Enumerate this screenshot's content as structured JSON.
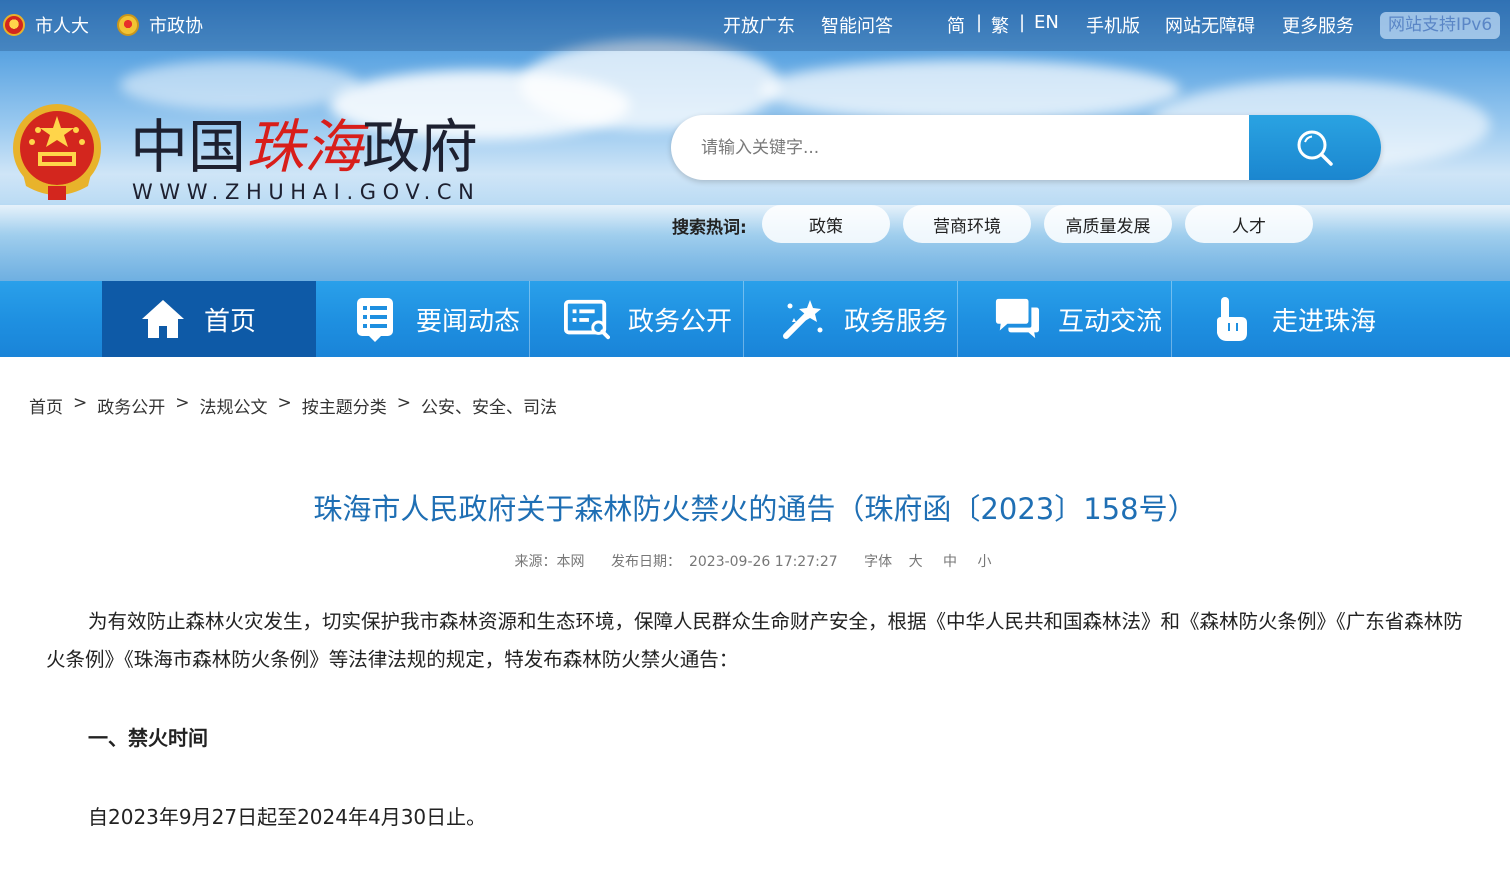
{
  "topbar": {
    "left_links": [
      "市人大",
      "市政协"
    ],
    "right_links": [
      "开放广东",
      "智能问答",
      "简",
      "繁",
      "EN",
      "手机版",
      "网站无障碍",
      "更多服务"
    ],
    "separators": [
      "|",
      "|"
    ],
    "ipv6_badge": "网站支持IPv6"
  },
  "logo": {
    "title_part1": "中国",
    "title_part2": "珠海",
    "title_part3": "政府",
    "url": "WWW.ZHUHAI.GOV.CN"
  },
  "search": {
    "placeholder": "请输入关键字...",
    "hot_label": "搜索热词:",
    "hot_tags": [
      "政策",
      "营商环境",
      "高质量发展",
      "人才"
    ],
    "button_icon": "search-icon"
  },
  "nav": {
    "items": [
      {
        "label": "首页",
        "icon": "home-icon"
      },
      {
        "label": "要闻动态",
        "icon": "news-list-icon"
      },
      {
        "label": "政务公开",
        "icon": "document-icon"
      },
      {
        "label": "政务服务",
        "icon": "magic-wand-icon"
      },
      {
        "label": "互动交流",
        "icon": "chat-icon"
      },
      {
        "label": "走进珠海",
        "icon": "hand-pointer-icon"
      }
    ]
  },
  "breadcrumb": {
    "items": [
      "首页",
      "政务公开",
      "法规公文",
      "按主题分类",
      "公安、安全、司法"
    ],
    "separator": ">"
  },
  "article": {
    "title": "珠海市人民政府关于森林防火禁火的通告（珠府函〔2023〕158号）",
    "meta": {
      "source_label": "来源：本网",
      "date_label": "发布日期：",
      "date_value": "2023-09-26 17:27:27",
      "font_label": "字体",
      "font_sizes": [
        "大",
        "中",
        "小"
      ]
    },
    "intro": "为有效防止森林火灾发生，切实保护我市森林资源和生态环境，保障人民群众生命财产安全，根据《中华人民共和国森林法》和《森林防火条例》《广东省森林防火条例》《珠海市森林防火条例》等法律法规的规定，特发布森林防火禁火通告：",
    "section1_heading": "一、禁火时间",
    "section1_text": "自2023年9月27日起至2024年4月30日止。"
  },
  "colors": {
    "nav_bg": "#1e8fe0",
    "nav_active": "#0e5aa7",
    "title_blue": "#1f6fb4",
    "brand_red": "#d81e1a",
    "search_button": "#1b86cf"
  }
}
